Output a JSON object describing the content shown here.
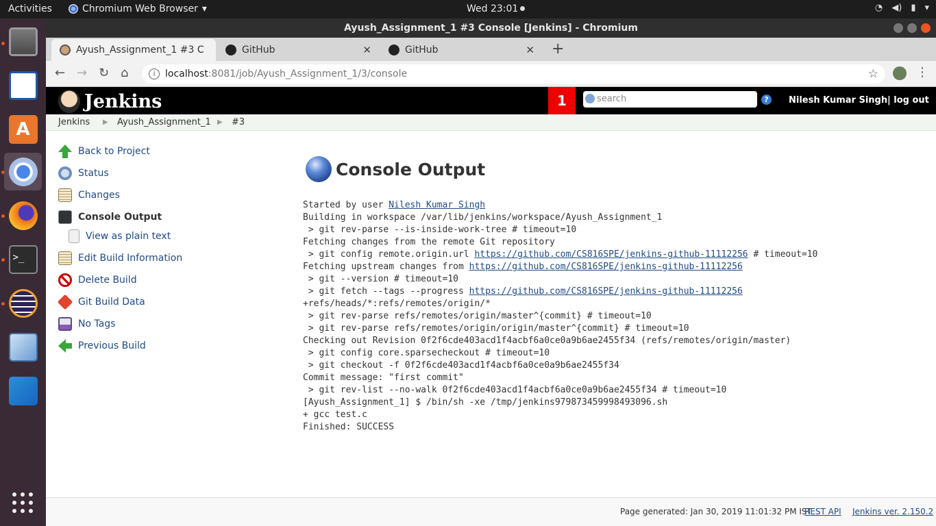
{
  "topbar": {
    "activities": "Activities",
    "app_name": "Chromium Web Browser",
    "clock": "Wed 23:01"
  },
  "window": {
    "title": "Ayush_Assignment_1 #3 Console [Jenkins] - Chromium"
  },
  "tabs": [
    {
      "label": "Ayush_Assignment_1 #3 C"
    },
    {
      "label": "GitHub"
    },
    {
      "label": "GitHub"
    }
  ],
  "address": {
    "host": "localhost",
    "path": ":8081/job/Ayush_Assignment_1/3/console"
  },
  "jenkins": {
    "brand": "Jenkins",
    "notification_count": "1",
    "search_placeholder": "search",
    "help": "?",
    "user": "Nilesh Kumar Singh",
    "logout": "| log out"
  },
  "breadcrumb": [
    "Jenkins",
    "Ayush_Assignment_1",
    "#3"
  ],
  "side_panel": [
    {
      "label": "Back to Project",
      "icon": "up-arrow-icon",
      "color": "#3aa63a"
    },
    {
      "label": "Status",
      "icon": "magnifier-icon",
      "color": "#8aa9d6"
    },
    {
      "label": "Changes",
      "icon": "notepad-icon",
      "color": "#e8d9a8"
    },
    {
      "label": "Console Output",
      "icon": "terminal-icon",
      "color": "#2e3436"
    },
    {
      "label": "View as plain text",
      "icon": "document-icon",
      "color": "#e6e6e6"
    },
    {
      "label": "Edit Build Information",
      "icon": "notepad-icon",
      "color": "#e8d9a8"
    },
    {
      "label": "Delete Build",
      "icon": "no-entry-icon",
      "color": "#cc0000"
    },
    {
      "label": "Git Build Data",
      "icon": "git-icon",
      "color": "#e0452f"
    },
    {
      "label": "No Tags",
      "icon": "save-icon",
      "color": "#8a5bb5"
    },
    {
      "label": "Previous Build",
      "icon": "left-arrow-icon",
      "color": "#3aa63a"
    }
  ],
  "main": {
    "title": "Console Output",
    "started_by": "Started by user ",
    "started_user": "Nilesh Kumar Singh",
    "l2": "Building in workspace /var/lib/jenkins/workspace/Ayush_Assignment_1",
    "l3": " > git rev-parse --is-inside-work-tree # timeout=10",
    "l4": "Fetching changes from the remote Git repository",
    "l5_pre": " > git config remote.origin.url ",
    "repo_url": "https://github.com/CS816SPE/jenkins-github-11112256",
    "l5_post": " # timeout=10",
    "l6_pre": "Fetching upstream changes from ",
    "l7": " > git --version # timeout=10",
    "l8_pre": " > git fetch --tags --progress ",
    "l9": "+refs/heads/*:refs/remotes/origin/*",
    "l10": " > git rev-parse refs/remotes/origin/master^{commit} # timeout=10",
    "l11": " > git rev-parse refs/remotes/origin/origin/master^{commit} # timeout=10",
    "l12": "Checking out Revision 0f2f6cde403acd1f4acbf6a0ce0a9b6ae2455f34 (refs/remotes/origin/master)",
    "l13": " > git config core.sparsecheckout # timeout=10",
    "l14": " > git checkout -f 0f2f6cde403acd1f4acbf6a0ce0a9b6ae2455f34",
    "l15": "Commit message: \"first commit\"",
    "l16": " > git rev-list --no-walk 0f2f6cde403acd1f4acbf6a0ce0a9b6ae2455f34 # timeout=10",
    "l17": "[Ayush_Assignment_1] $ /bin/sh -xe /tmp/jenkins979873459998493096.sh",
    "l18": "+ gcc test.c",
    "l19": "Finished: SUCCESS"
  },
  "footer": {
    "generated": "Page generated: Jan 30, 2019 11:01:32 PM IST",
    "rest_api": "REST API",
    "version": "Jenkins ver. 2.150.2"
  }
}
